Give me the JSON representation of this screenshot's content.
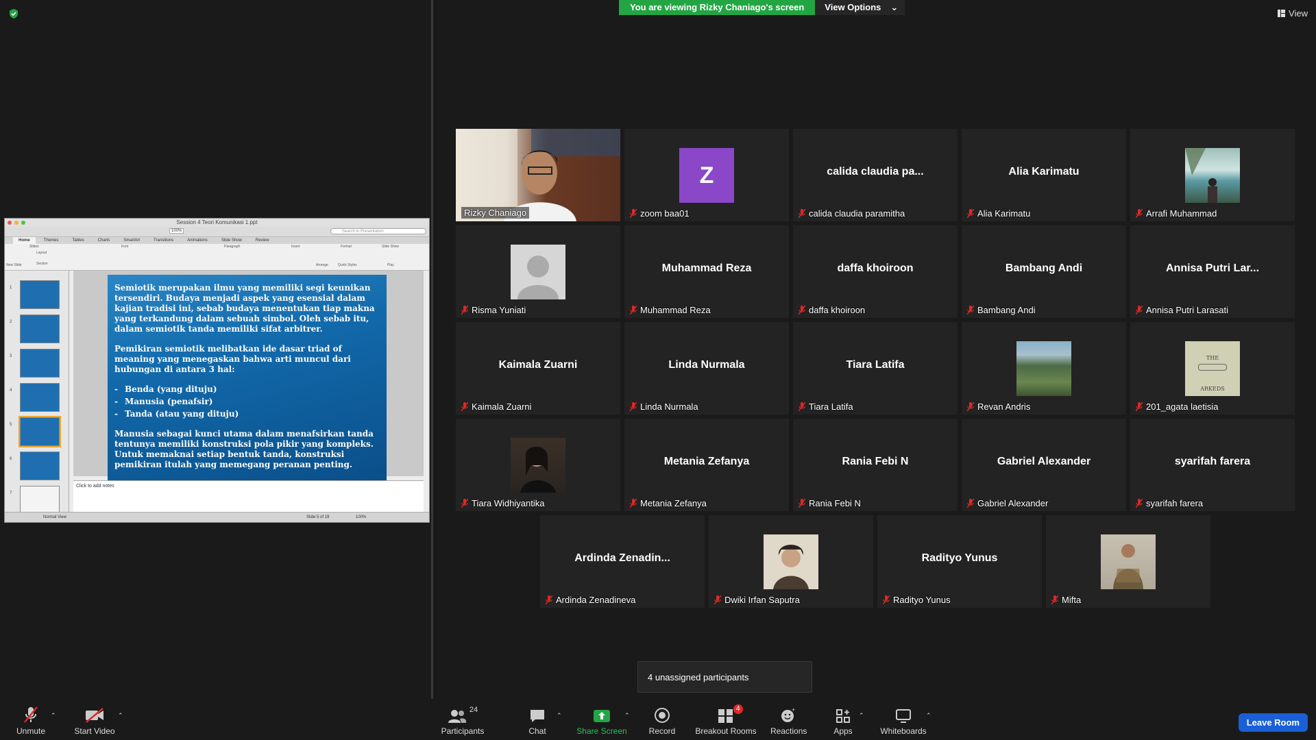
{
  "banner": {
    "viewing": "You are viewing Rizky Chaniago's screen",
    "view_options": "View Options"
  },
  "view_btn": "View",
  "shared_app": {
    "title": "Session 4 Teori Komunikasi 1.ppt",
    "search_placeholder": "Search in Presentation",
    "zoom": "100%",
    "tabs": [
      "Home",
      "Themes",
      "Tables",
      "Charts",
      "SmartArt",
      "Transitions",
      "Animations",
      "Slide Show",
      "Review"
    ],
    "ribbon_groups": [
      "Slides",
      "Font",
      "Paragraph",
      "Insert",
      "Format",
      "Slide Show"
    ],
    "ribbon_buttons": [
      "New Slide",
      "Layout",
      "Section",
      "Arrange",
      "Quick Styles",
      "Play"
    ],
    "slide_para1": "Semiotik merupakan ilmu yang memiliki segi keunikan tersendiri. Budaya menjadi aspek yang esensial dalam kajian tradisi ini, sebab budaya menentukan tiap makna yang terkandung dalam sebuah simbol. Oleh sebab itu, dalam semiotik tanda memiliki sifat arbitrer.",
    "slide_para2": "Pemikiran semiotik melibatkan ide dasar triad of meaning yang menegaskan bahwa arti muncul dari hubungan di antara 3 hal:",
    "slide_bullets": [
      "Benda (yang dituju)",
      "Manusia (penafsir)",
      "Tanda (atau yang dituju)"
    ],
    "slide_para3": "Manusia sebagai kunci utama dalam menafsirkan tanda tentunya memiliki konstruksi pola pikir yang kompleks. Untuk memaknai setiap bentuk tanda, konstruksi pemikiran itulah yang memegang peranan penting.",
    "notes": "Click to add notes",
    "status_view": "Normal View",
    "status_slide": "Slide 5 of 19",
    "status_zoom": "100%",
    "thumb_numbers": [
      "1",
      "2",
      "3",
      "4",
      "5",
      "6",
      "7"
    ]
  },
  "participants": [
    {
      "name": "Rizky Chaniago",
      "big": "",
      "kind": "video"
    },
    {
      "name": "zoom baa01",
      "big": "Z",
      "kind": "avatar-z"
    },
    {
      "name": "calida claudia paramitha",
      "big": "calida claudia pa...",
      "kind": "name"
    },
    {
      "name": "Alia Karimatu",
      "big": "Alia Karimatu",
      "kind": "name"
    },
    {
      "name": "Arrafi Muhammad",
      "big": "",
      "kind": "photo-lake"
    },
    {
      "name": "Risma Yuniati",
      "big": "",
      "kind": "avatar-default"
    },
    {
      "name": "Muhammad Reza",
      "big": "Muhammad Reza",
      "kind": "name"
    },
    {
      "name": "daffa khoiroon",
      "big": "daffa khoiroon",
      "kind": "name"
    },
    {
      "name": "Bambang Andi",
      "big": "Bambang Andi",
      "kind": "name"
    },
    {
      "name": "Annisa Putri Larasati",
      "big": "Annisa Putri Lar...",
      "kind": "name"
    },
    {
      "name": "Kaimala Zuarni",
      "big": "Kaimala Zuarni",
      "kind": "name"
    },
    {
      "name": "Linda Nurmala",
      "big": "Linda Nurmala",
      "kind": "name"
    },
    {
      "name": "Tiara Latifa",
      "big": "Tiara Latifa",
      "kind": "name"
    },
    {
      "name": "Revan Andris",
      "big": "",
      "kind": "photo-hill"
    },
    {
      "name": "201_agata laetisia",
      "big": "",
      "kind": "photo-book"
    },
    {
      "name": "Tiara Widhiyantika",
      "big": "",
      "kind": "photo-woman"
    },
    {
      "name": "Metania Zefanya",
      "big": "Metania Zefanya",
      "kind": "name"
    },
    {
      "name": "Rania Febi N",
      "big": "Rania Febi N",
      "kind": "name"
    },
    {
      "name": "Gabriel Alexander",
      "big": "Gabriel Alexander",
      "kind": "name"
    },
    {
      "name": "syarifah farera",
      "big": "syarifah farera",
      "kind": "name"
    },
    {
      "name": "Ardinda Zenadineva",
      "big": "Ardinda  Zenadin...",
      "kind": "name"
    },
    {
      "name": "Dwiki Irfan Saputra",
      "big": "",
      "kind": "photo-man"
    },
    {
      "name": "Radityo Yunus",
      "big": "Radityo Yunus",
      "kind": "name"
    },
    {
      "name": "Mifta",
      "big": "",
      "kind": "photo-mifta"
    }
  ],
  "book_text": {
    "top": "THE",
    "bottom": "ARKEDS"
  },
  "tooltip": "4 unassigned participants",
  "toolbar": {
    "unmute": "Unmute",
    "start_video": "Start Video",
    "participants": "Participants",
    "participants_count": "24",
    "chat": "Chat",
    "share_screen": "Share Screen",
    "record": "Record",
    "breakout_rooms": "Breakout Rooms",
    "breakout_badge": "4",
    "reactions": "Reactions",
    "apps": "Apps",
    "whiteboards": "Whiteboards",
    "leave_room": "Leave Room"
  },
  "colors": {
    "share_green": "#23a544",
    "speaker_outline": "#c6e01e",
    "leave_blue": "#1a5fd6",
    "mic_red": "#e02828"
  }
}
